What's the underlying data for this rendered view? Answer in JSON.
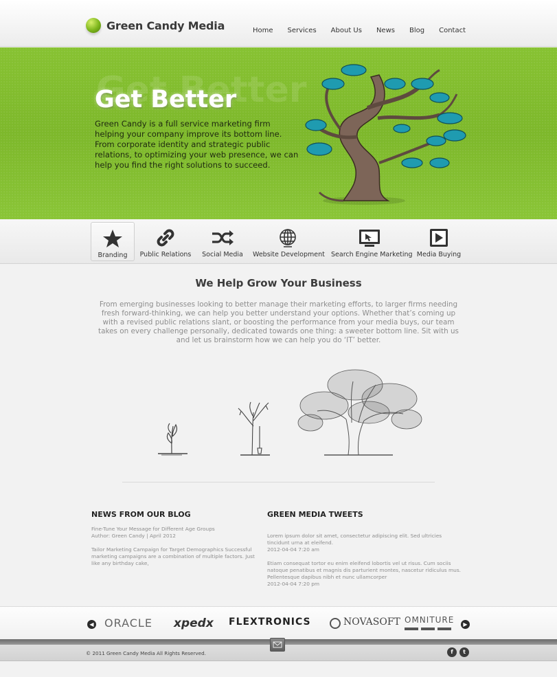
{
  "brand": {
    "name": "Green Candy Media"
  },
  "nav": [
    {
      "label": "Home"
    },
    {
      "label": "Services"
    },
    {
      "label": "About Us"
    },
    {
      "label": "News"
    },
    {
      "label": "Blog"
    },
    {
      "label": "Contact"
    }
  ],
  "hero": {
    "ghost": "Get Better",
    "title": "Get Better",
    "text": "Green Candy is a full service marketing firm helping your company improve its bottom line. From corporate identity and strategic public relations, to optimizing your web presence, we can help you find the right solutions to succeed."
  },
  "services": [
    {
      "label": "Branding",
      "icon": "star-icon"
    },
    {
      "label": "Public Relations",
      "icon": "link-icon"
    },
    {
      "label": "Social Media",
      "icon": "shuffle-icon"
    },
    {
      "label": "Website Development",
      "icon": "globe-icon"
    },
    {
      "label": "Search Engine Marketing",
      "icon": "monitor-cursor-icon"
    },
    {
      "label": "Media Buying",
      "icon": "play-icon"
    }
  ],
  "main": {
    "title": "We Help Grow Your Business",
    "text": "From emerging businesses looking to better manage their marketing efforts, to larger firms needing fresh forward-thinking, we can help you better understand your options. Whether that’s coming up with a revised public relations slant, or boosting the performance from your media buys, our team takes on every challenge personally, dedicated towards one thing: a sweeter bottom line. Sit with us and let us brainstorm how we can help you do ‘IT’ better."
  },
  "blog": {
    "title": "NEWS FROM OUR BLOG",
    "post_title": "Fine-Tune Your Message for Different Age Groups",
    "post_meta": "Author: Green Candy | April 2012",
    "post_excerpt": "Tailor Marketing Campaign for Target Demographics Successful marketing campaigns are a combination of multiple factors. Just like any birthday cake,"
  },
  "tweets": {
    "title": "GREEN MEDIA TWEETS",
    "items": [
      {
        "text": "Lorem ipsum dolor sit amet, consectetur adipiscing elit. Sed ultricies tincidunt urna at eleifend.",
        "time": "2012-04-04 7:20 am"
      },
      {
        "text": "Etiam consequat tortor eu enim eleifend lobortis vel ut risus. Cum sociis natoque penatibus et magnis dis parturient montes, nascetur ridiculus mus. Pellentesque dapibus nibh et nunc ullamcorper",
        "time": "2012-04-04 7:20 pm"
      }
    ]
  },
  "partners": [
    "ORACLE",
    "xpedx",
    "FLEXTRONICS",
    "NOVASOFT",
    "OMNITURE"
  ],
  "footer": {
    "copyright": "© 2011  Green Candy Media  All Rights Reserved.",
    "social": [
      "f",
      "t"
    ]
  },
  "colors": {
    "brand_green": "#7db82b",
    "tree_teal": "#1f9bb0"
  }
}
